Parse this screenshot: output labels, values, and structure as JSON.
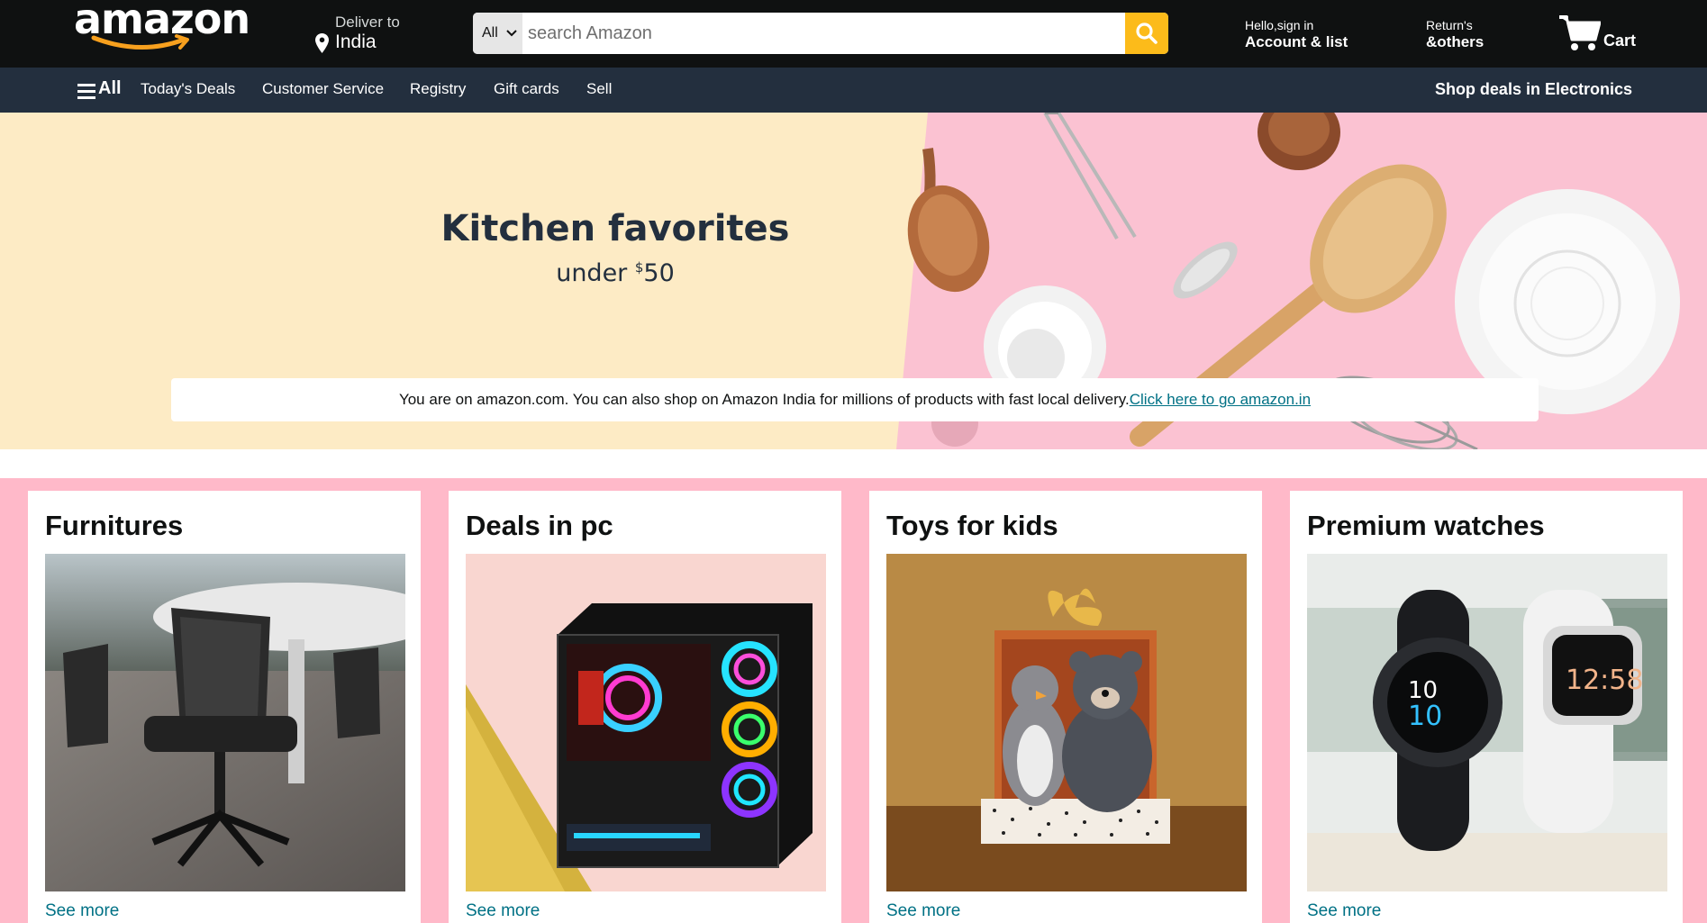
{
  "header": {
    "logo_text": "amazon",
    "deliver_label": "Deliver to",
    "deliver_location": "India",
    "search": {
      "category": "All",
      "placeholder": "search Amazon",
      "button_icon": "search-icon"
    },
    "account": {
      "small": "Hello,sign in",
      "big": "Account & list"
    },
    "returns": {
      "small": "Return's",
      "big": "&others"
    },
    "cart_label": "Cart",
    "colors": {
      "header_bg": "#0f1111",
      "nav_bg": "#232f3e",
      "search_button": "#fcbb1a",
      "brand_orange": "#f7a01e"
    }
  },
  "nav": {
    "all_label": "All",
    "items": [
      "Today's Deals",
      "Customer Service",
      "Registry",
      "Gift cards",
      "Sell"
    ],
    "right_label": "Shop deals in Electronics"
  },
  "hero": {
    "title": "Kitchen favorites",
    "subtitle_prefix": "under ",
    "subtitle_currency": "$",
    "subtitle_amount": "50",
    "notice_text": "You are on amazon.com. You can also shop on Amazon India for millions of products with fast local delivery.",
    "notice_link": "Click here to go amazon.in"
  },
  "cards": [
    {
      "title": "Furnitures",
      "link": "See more"
    },
    {
      "title": "Deals in pc",
      "link": "See more"
    },
    {
      "title": "Toys for kids",
      "link": "See more"
    },
    {
      "title": "Premium watches",
      "link": "See more"
    }
  ]
}
